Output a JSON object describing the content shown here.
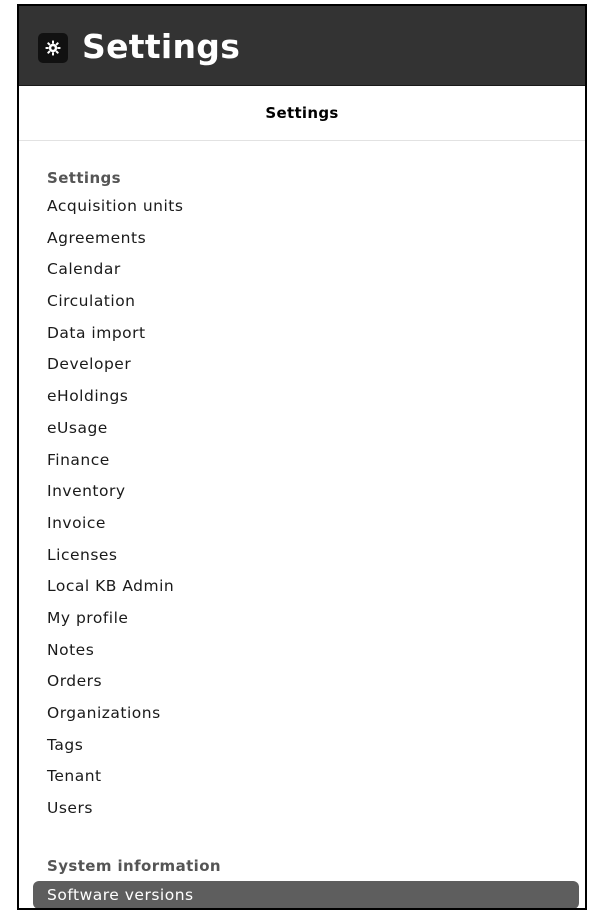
{
  "app": {
    "title": "Settings",
    "icon": "gear-icon"
  },
  "pane": {
    "title": "Settings"
  },
  "sections": [
    {
      "label": "Settings",
      "items": [
        "Acquisition units",
        "Agreements",
        "Calendar",
        "Circulation",
        "Data import",
        "Developer",
        "eHoldings",
        "eUsage",
        "Finance",
        "Inventory",
        "Invoice",
        "Licenses",
        "Local KB Admin",
        "My profile",
        "Notes",
        "Orders",
        "Organizations",
        "Tags",
        "Tenant",
        "Users"
      ]
    },
    {
      "label": "System information",
      "items": [
        "Software versions"
      ],
      "selected": "Software versions"
    }
  ],
  "colors": {
    "header_bg": "#333333",
    "selected_bg": "#5e5e5e",
    "section_label": "#555555"
  }
}
